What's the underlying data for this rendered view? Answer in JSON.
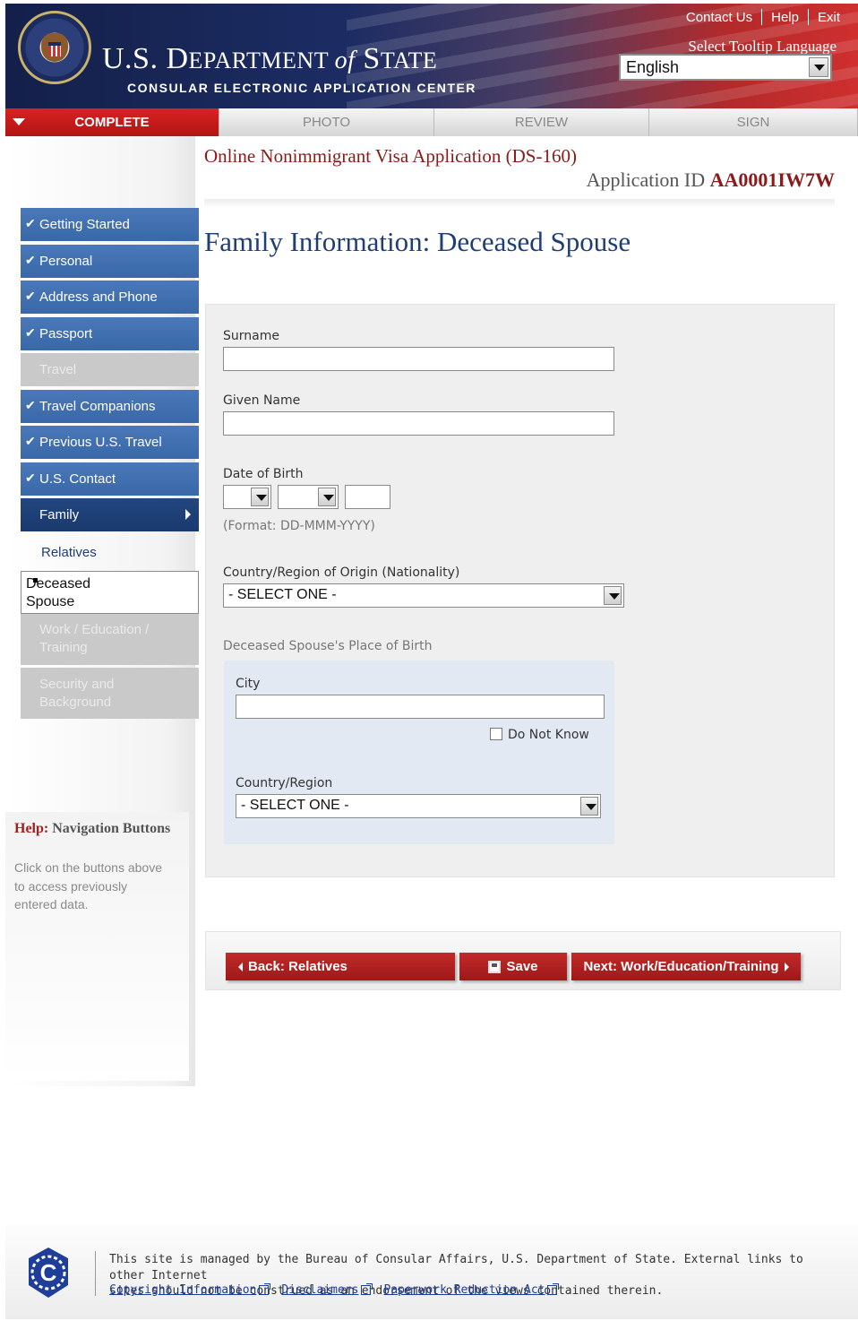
{
  "header": {
    "links": [
      "Contact Us",
      "Help",
      "Exit"
    ],
    "title_a": "U.S. D",
    "title_b": "EPARTMENT ",
    "title_of": "of",
    "title_c": " S",
    "title_d": "TATE",
    "subtitle": "CONSULAR ELECTRONIC APPLICATION CENTER",
    "tooltip_label": "Select Tooltip Language",
    "language": "English"
  },
  "progress_tabs": [
    "COMPLETE",
    "PHOTO",
    "REVIEW",
    "SIGN"
  ],
  "nav": {
    "getting_started": "Getting Started",
    "personal": "Personal",
    "address": "Address and Phone",
    "passport": "Passport",
    "travel": "Travel",
    "companions": "Travel Companions",
    "previous": "Previous U.S. Travel",
    "contact": "U.S. Contact",
    "family": "Family",
    "relatives": "Relatives",
    "deceased_1": "Deceased",
    "deceased_2": "Spouse",
    "work_1": "Work / Education /",
    "work_2": "Training",
    "security_1": "Security and",
    "security_2": "Background"
  },
  "help": {
    "title_red": "Help:",
    "title_rest": " Navigation Buttons",
    "line1": "Click on the buttons above",
    "line2": "to access previously",
    "line3": "entered data."
  },
  "main": {
    "form_title": "Online Nonimmigrant Visa Application (DS-160)",
    "appid_label": "Application ID ",
    "appid_value": "AA0001IW7W",
    "page_title": "Family Information: Deceased Spouse",
    "surname_label": "Surname",
    "given_label": "Given Name",
    "dob_label": "Date of Birth",
    "dob_format": "(Format: DD-MMM-YYYY)",
    "nationality_label": "Country/Region of Origin (Nationality)",
    "select_one": "- SELECT ONE -",
    "pob_label": "Deceased Spouse's Place of Birth",
    "city_label": "City",
    "do_not_know": "Do Not Know",
    "country_label": "Country/Region"
  },
  "buttons": {
    "back": "Back: Relatives",
    "save": "Save",
    "next": "Next: Work/Education/Training"
  },
  "footer": {
    "line1": "This site is managed by the Bureau of Consular Affairs, U.S. Department of State. External links to other Internet",
    "line2": "sites should not be construed as an endorsement of the views contained therein.",
    "copyright": "Copyright Information",
    "disclaimers": "Disclaimers",
    "paperwork": "Paperwork Reduction Act"
  },
  "colors": {
    "accent_red": "#b21414",
    "nav_blue": "#3968a8",
    "nav_current": "#1a3a6e",
    "title_blue": "#1f3e74"
  }
}
